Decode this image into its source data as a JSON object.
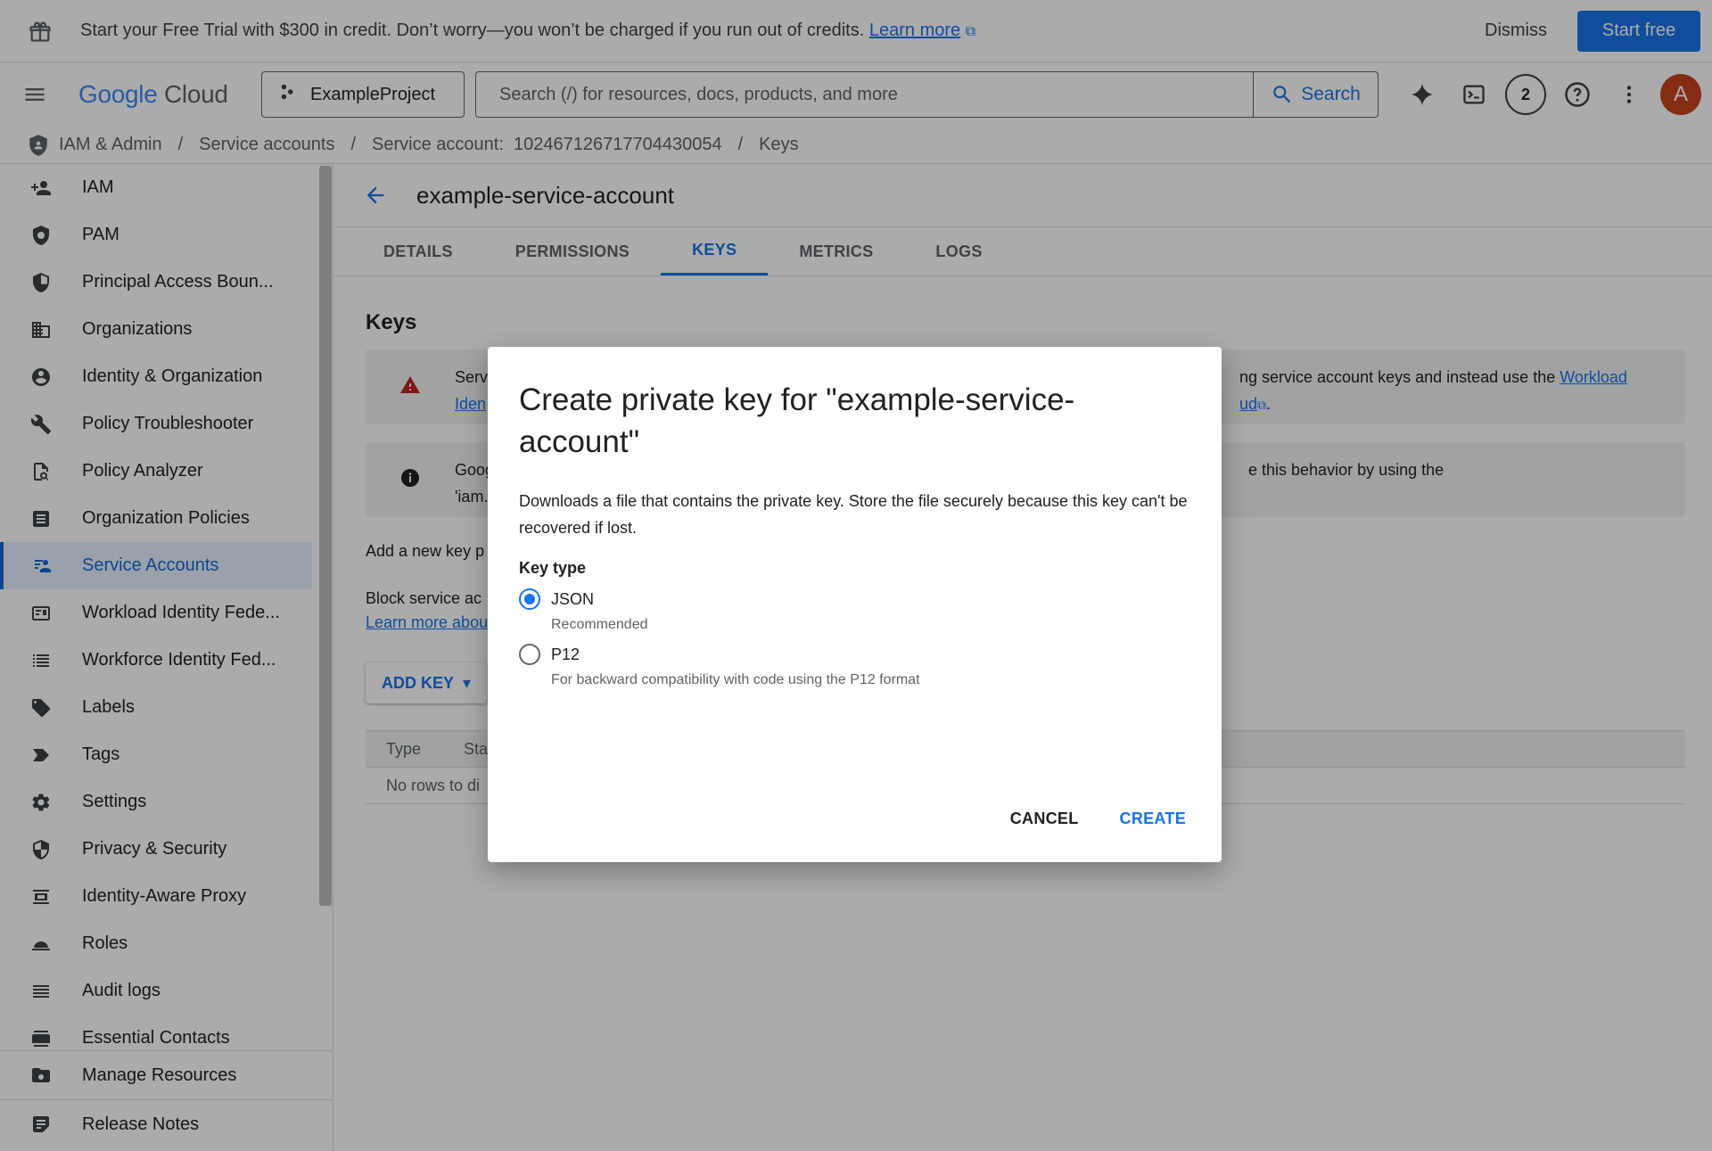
{
  "banner": {
    "message": "Start your Free Trial with $300 in credit. Don’t worry—you won’t be charged if you run out of credits.",
    "learn_more": "Learn more",
    "dismiss": "Dismiss",
    "start_free": "Start free"
  },
  "topbar": {
    "logo_google": "Google",
    "logo_cloud": "Cloud",
    "project": "ExampleProject",
    "search_placeholder": "Search (/) for resources, docs, products, and more",
    "search_button": "Search",
    "notifications_count": "2",
    "avatar_letter": "A"
  },
  "breadcrumb": [
    "IAM & Admin",
    "Service accounts",
    "Service account:  102467126717704430054",
    "Keys"
  ],
  "sidebar": {
    "items": [
      {
        "label": "IAM",
        "icon": "person-add-icon"
      },
      {
        "label": "PAM",
        "icon": "shield-icon"
      },
      {
        "label": "Principal Access Boun...",
        "icon": "shield-lock-icon"
      },
      {
        "label": "Organizations",
        "icon": "building-icon"
      },
      {
        "label": "Identity & Organization",
        "icon": "account-circle-icon"
      },
      {
        "label": "Policy Troubleshooter",
        "icon": "wrench-icon"
      },
      {
        "label": "Policy Analyzer",
        "icon": "document-search-icon"
      },
      {
        "label": "Organization Policies",
        "icon": "list-document-icon"
      },
      {
        "label": "Service Accounts",
        "icon": "service-account-icon"
      },
      {
        "label": "Workload Identity Fede...",
        "icon": "id-card-icon"
      },
      {
        "label": "Workforce Identity Fed...",
        "icon": "list-icon"
      },
      {
        "label": "Labels",
        "icon": "tag-icon"
      },
      {
        "label": "Tags",
        "icon": "label-arrow-icon"
      },
      {
        "label": "Settings",
        "icon": "gear-icon"
      },
      {
        "label": "Privacy & Security",
        "icon": "shield-half-icon"
      },
      {
        "label": "Identity-Aware Proxy",
        "icon": "proxy-icon"
      },
      {
        "label": "Roles",
        "icon": "hat-icon"
      },
      {
        "label": "Audit logs",
        "icon": "lines-icon"
      },
      {
        "label": "Essential Contacts",
        "icon": "contacts-icon"
      }
    ],
    "active_index": 8,
    "bottom": [
      {
        "label": "Manage Resources",
        "icon": "folder-gear-icon"
      },
      {
        "label": "Release Notes",
        "icon": "notes-icon"
      }
    ]
  },
  "page": {
    "title": "example-service-account",
    "tabs": [
      "DETAILS",
      "PERMISSIONS",
      "KEYS",
      "METRICS",
      "LOGS"
    ],
    "active_tab": 2,
    "section_title": "Keys",
    "warning_line1_start": "Serv",
    "warning_line1_end": "ng service account keys and instead use the",
    "warning_link_workload": "Workload",
    "warning_line2_start": "Iden",
    "warning_line2_link": "ud",
    "warning_line2_end": ".",
    "info_line1_start": "Goog",
    "info_line1_end": "e this behavior by using the",
    "info_line2_start": "'iam.",
    "add_new_key": "Add a new key p",
    "block_text": "Block service ac",
    "learn_more_about": "Learn more abou",
    "add_key_button": "ADD KEY",
    "table_headers": [
      "Type",
      "Sta"
    ],
    "table_empty": "No rows to di"
  },
  "dialog": {
    "title": "Create private key for \"example-service-account\"",
    "description": "Downloads a file that contains the private key. Store the file securely because this key can't be recovered if lost.",
    "key_type_label": "Key type",
    "options": [
      {
        "label": "JSON",
        "sub": "Recommended",
        "selected": true
      },
      {
        "label": "P12",
        "sub": "For backward compatibility with code using the P12 format",
        "selected": false
      }
    ],
    "cancel": "CANCEL",
    "create": "CREATE"
  },
  "colors": {
    "accent": "#1a73e8",
    "avatar": "#c5441c",
    "warning": "#c5221f"
  }
}
